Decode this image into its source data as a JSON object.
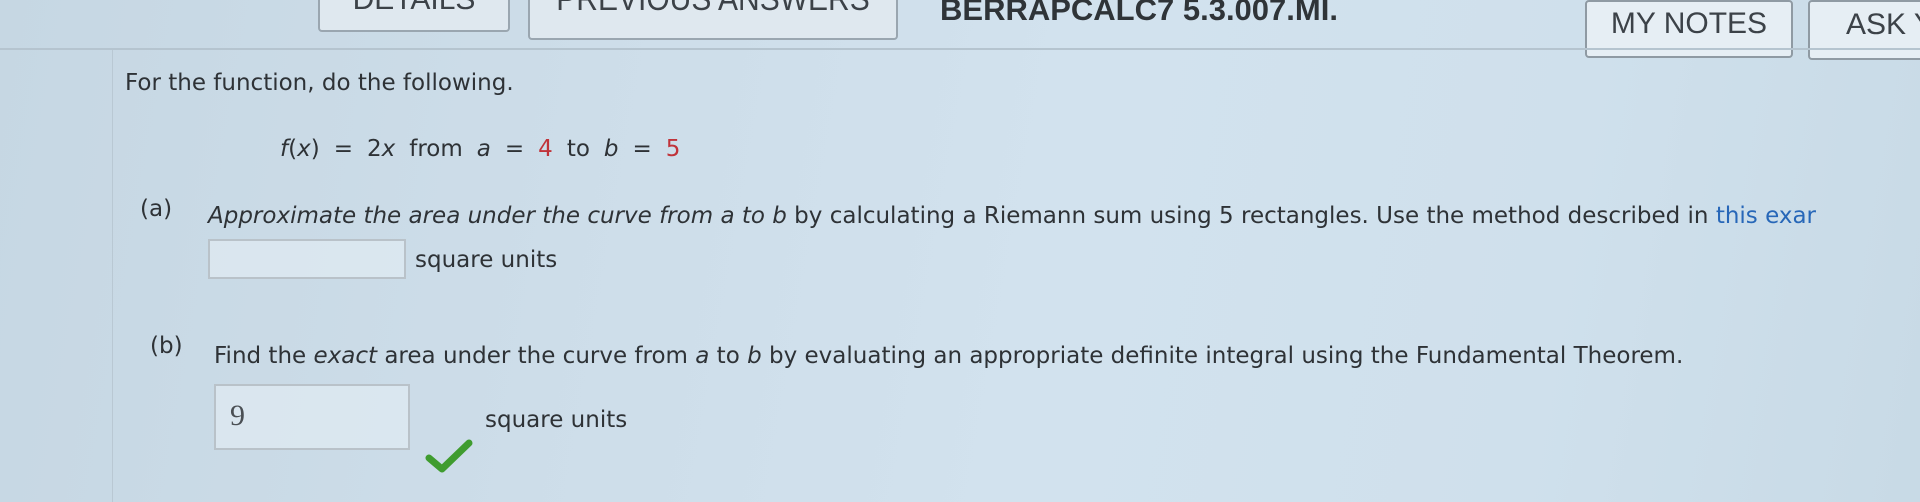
{
  "toolbar": {
    "details_label": "DETAILS",
    "previous_answers_label": "PREVIOUS ANSWERS",
    "problem_id": "BERRAPCALC7 5.3.007.MI.",
    "my_notes_label": "MY NOTES",
    "ask_label": "ASK Y"
  },
  "question": {
    "instruction": "For the function, do the following.",
    "function": {
      "name": "f",
      "var": "x",
      "rhs_coef": "2",
      "from_word": "from",
      "a_var": "a",
      "a_value": "4",
      "to_word": "to",
      "b_var": "b",
      "b_value": "5"
    },
    "part_a": {
      "label": "(a)",
      "text_1": "Approximate the area under the curve from ",
      "a": "a",
      "to": " to ",
      "b": "b",
      "text_2": " by calculating a Riemann sum using 5 rectangles. Use the method described in ",
      "link_text": "this exar",
      "answer_value": "",
      "units": "square units"
    },
    "part_b": {
      "label": "(b)",
      "text_1": "Find the ",
      "exact": "exact",
      "text_2": " area under the curve from ",
      "a": "a",
      "to": " to ",
      "b": "b",
      "text_3": " by evaluating an appropriate definite integral using the Fundamental Theorem.",
      "answer_value": "9",
      "units": "square units"
    }
  },
  "icons": {
    "correct": "check-icon"
  },
  "colors": {
    "red_value": "#c0333a",
    "link": "#2767b8",
    "check": "#3f9c2f"
  }
}
